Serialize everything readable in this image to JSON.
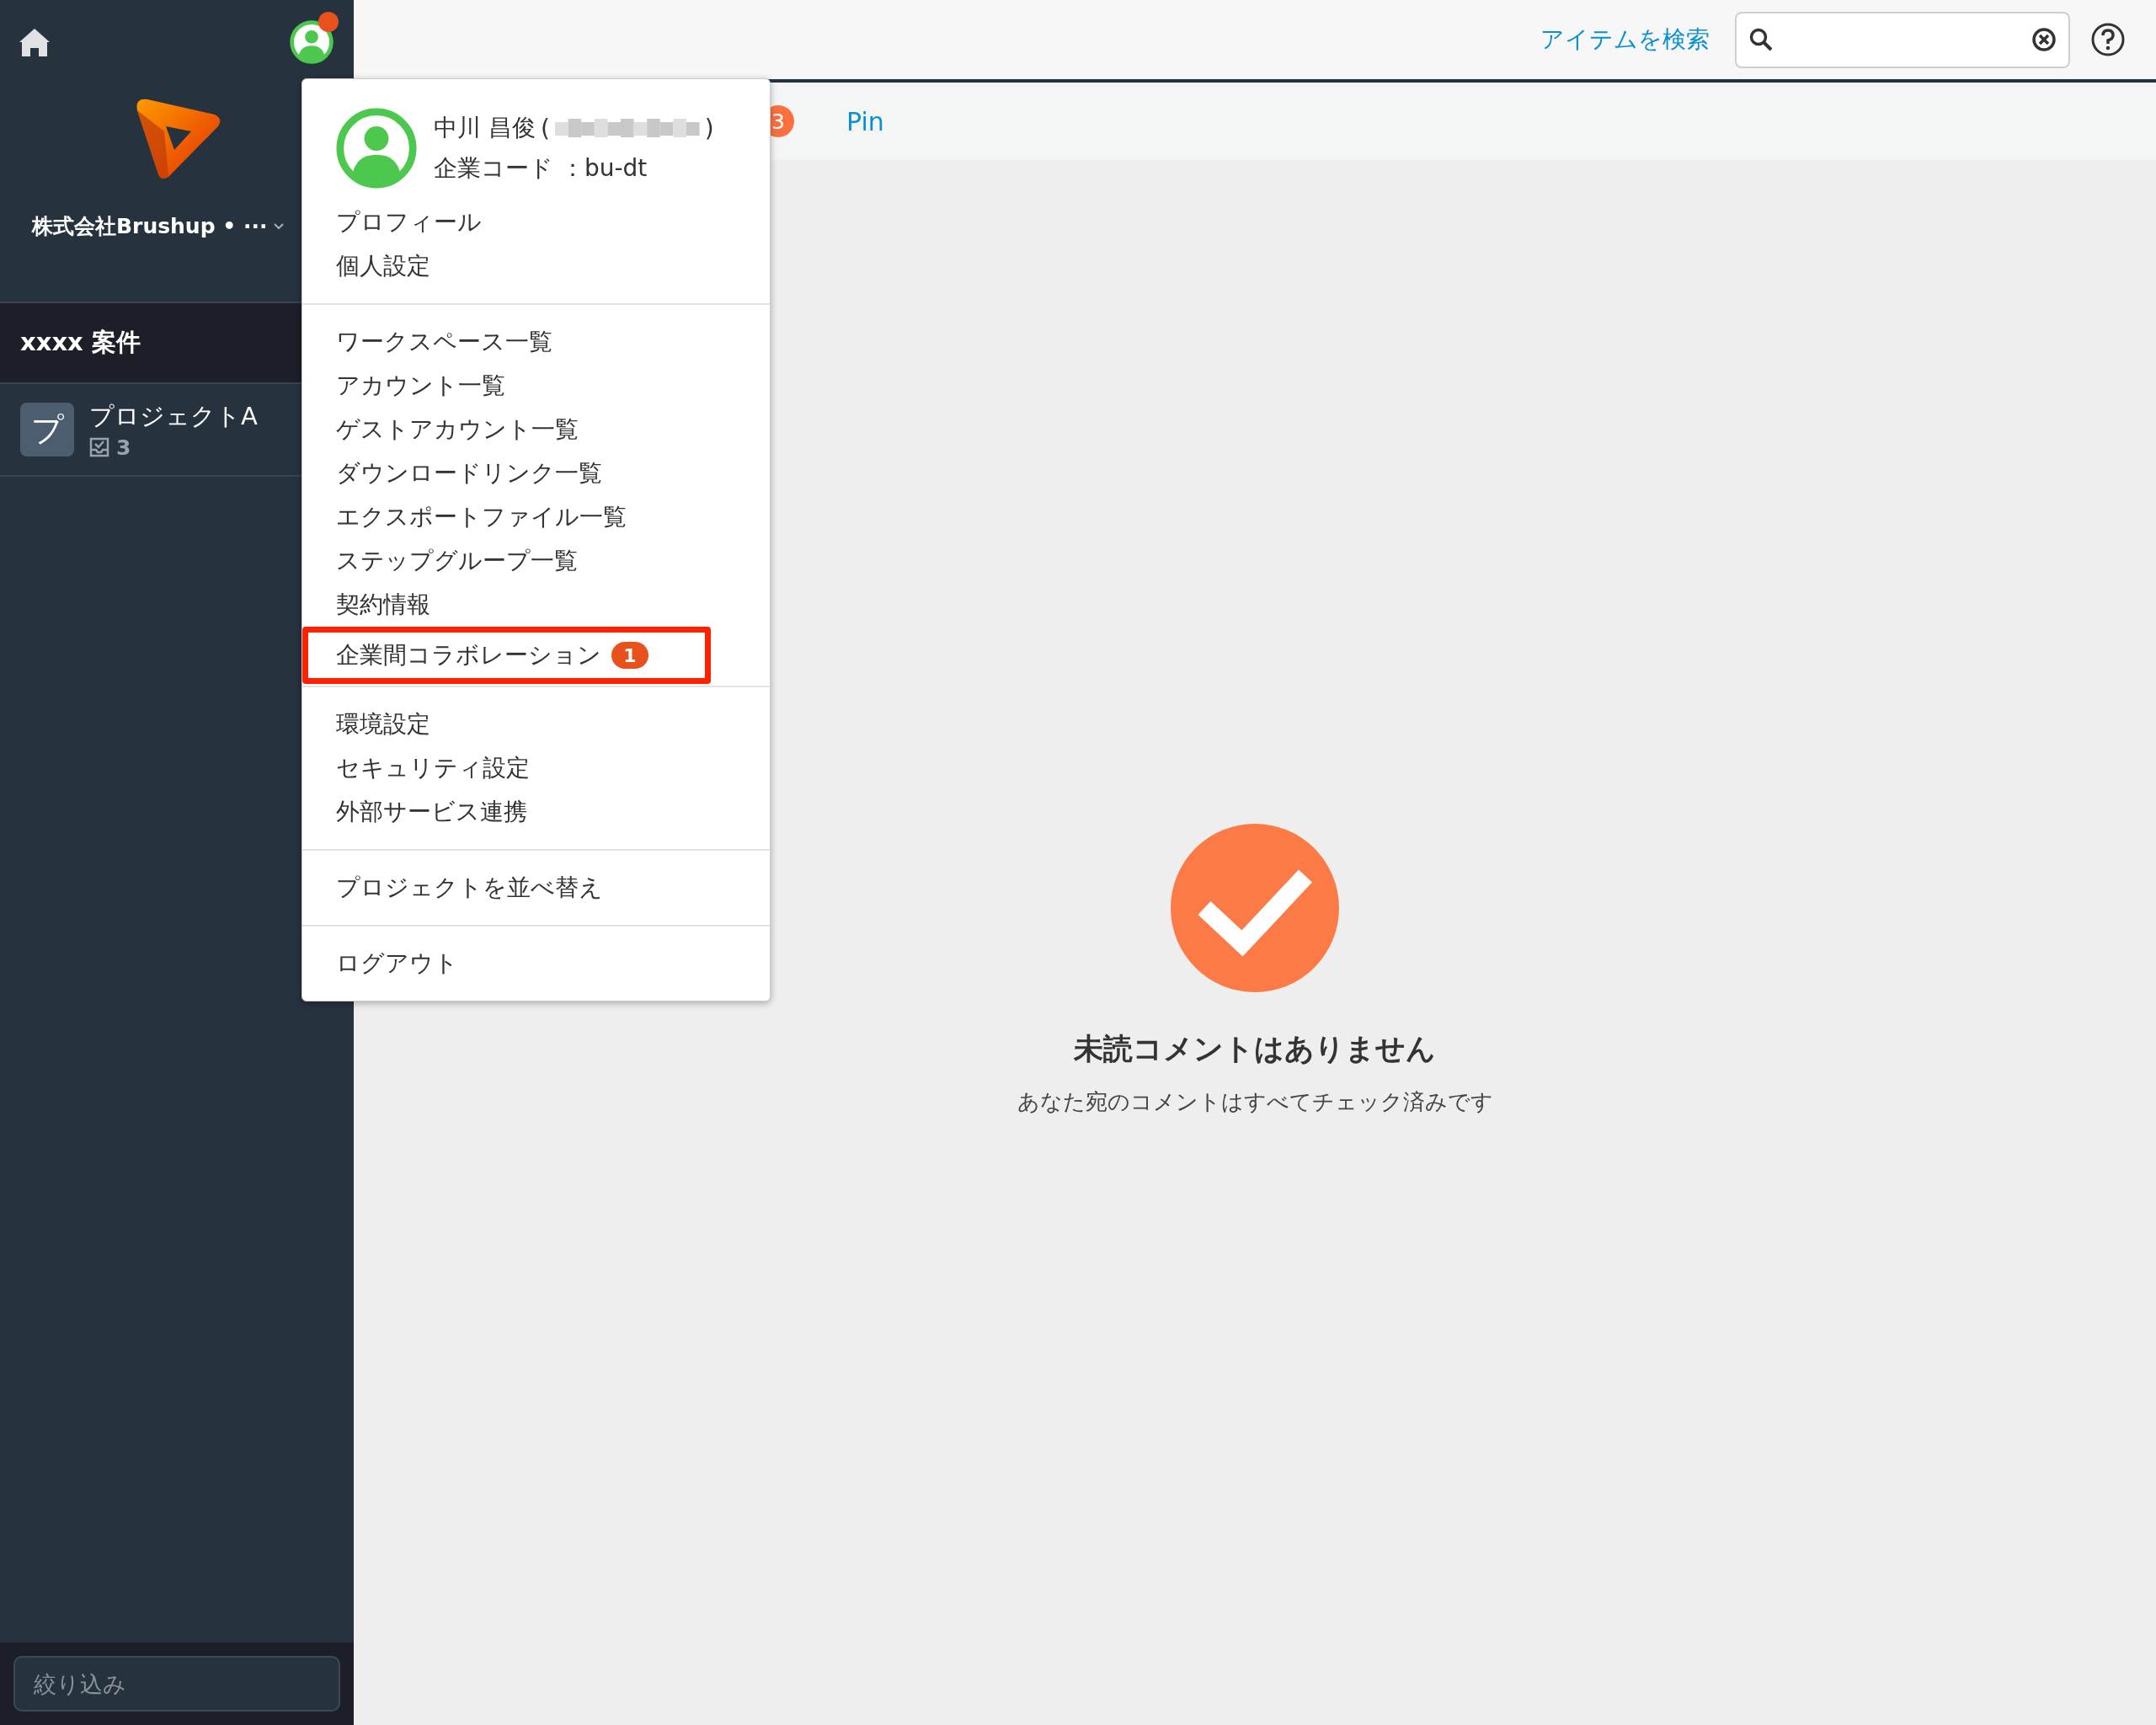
{
  "sidebar": {
    "company": "株式会社Brushup • ···",
    "section_title": "xxxx 案件",
    "projects": [
      {
        "initial": "プ",
        "name": "プロジェクトA",
        "count": "3"
      }
    ],
    "filter": {
      "placeholder": "絞り込み"
    }
  },
  "topbar": {
    "search_link": "アイテムを検索"
  },
  "tabs": [
    {
      "kind": "badge",
      "text": "3"
    },
    {
      "kind": "label",
      "text": "Pin"
    }
  ],
  "user_menu": {
    "name": "中川 昌俊",
    "paren_open": "(",
    "paren_close": ")",
    "company_code": "企業コード ：bu-dt",
    "groups": [
      {
        "items": [
          {
            "label": "プロフィール",
            "highlighted": false
          },
          {
            "label": "個人設定",
            "highlighted": false
          }
        ]
      },
      {
        "items": [
          {
            "label": "ワークスペース一覧",
            "highlighted": false
          },
          {
            "label": "アカウント一覧",
            "highlighted": false
          },
          {
            "label": "ゲストアカウント一覧",
            "highlighted": false
          },
          {
            "label": "ダウンロードリンク一覧",
            "highlighted": false
          },
          {
            "label": "エクスポートファイル一覧",
            "highlighted": false
          },
          {
            "label": "ステップグループ一覧",
            "highlighted": false
          },
          {
            "label": "契約情報",
            "highlighted": false
          },
          {
            "label": "企業間コラボレーション",
            "badge": "1",
            "highlighted": true
          }
        ]
      },
      {
        "items": [
          {
            "label": "環境設定",
            "highlighted": false
          },
          {
            "label": "セキュリティ設定",
            "highlighted": false
          },
          {
            "label": "外部サービス連携",
            "highlighted": false
          }
        ]
      },
      {
        "items": [
          {
            "label": "プロジェクトを並べ替え",
            "highlighted": false
          }
        ]
      },
      {
        "items": [
          {
            "label": "ログアウト",
            "highlighted": false
          }
        ]
      }
    ]
  },
  "empty_state": {
    "title": "未読コメントはありません",
    "message": "あなた宛のコメントはすべてチェック済みです"
  }
}
